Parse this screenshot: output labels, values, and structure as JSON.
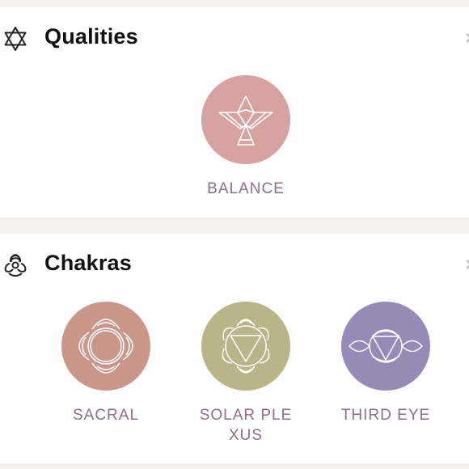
{
  "sections": {
    "qualities": {
      "title": "Qualities",
      "icon": "star-of-david-icon",
      "items": [
        {
          "label": "BALANCE",
          "icon": "bird-icon",
          "color": "#d6a3a0"
        }
      ]
    },
    "chakras": {
      "title": "Chakras",
      "icon": "biohazard-icon",
      "items": [
        {
          "label": "SACRAL",
          "icon": "sacral-chakra-icon",
          "color": "#c9968a"
        },
        {
          "label": "SOLAR PLEXUS",
          "icon": "solar-plexus-chakra-icon",
          "color": "#bab489"
        },
        {
          "label": "THIRD EYE",
          "icon": "third-eye-chakra-icon",
          "color": "#958bb6"
        }
      ]
    }
  },
  "colors": {
    "label": "#8c6e87",
    "title": "#111111",
    "background": "#f2f1f0"
  }
}
